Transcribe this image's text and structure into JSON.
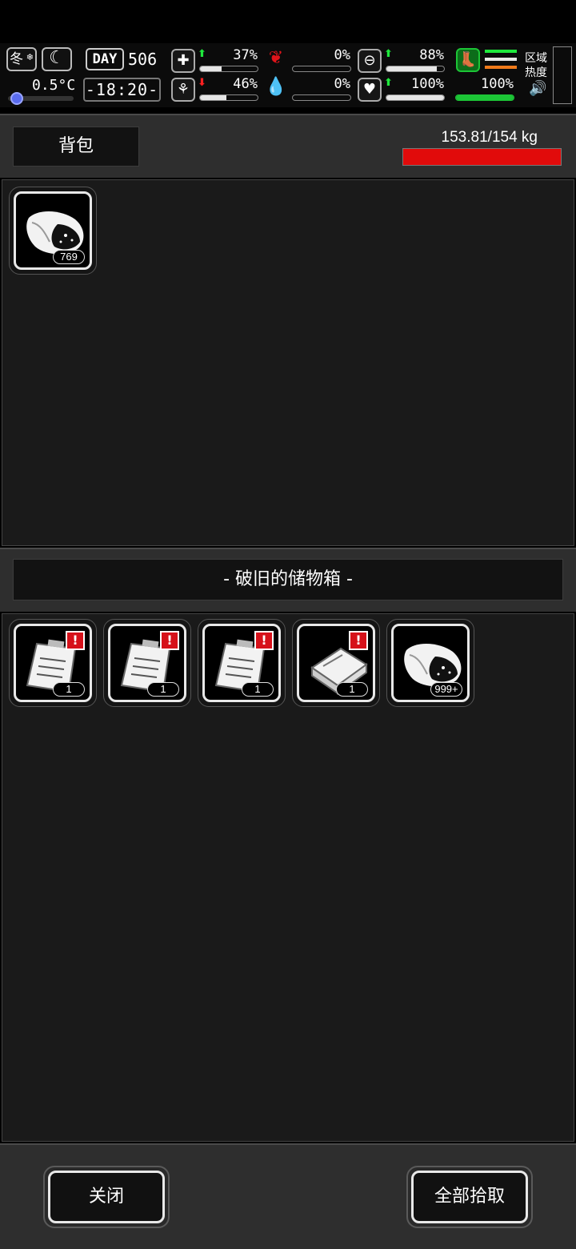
{
  "hud": {
    "season": "冬",
    "season_icon": "snowflake-icon",
    "time_icon": "moon-icon",
    "temperature": "0.5°C",
    "temperature_level": 0.05,
    "day_label": "DAY",
    "day_number": "506",
    "clock": "-18:20-",
    "stats": {
      "health": {
        "icon": "first-aid-icon",
        "trend": "up",
        "value": "37%",
        "level": 0.37
      },
      "hunger": {
        "icon": "stomach-icon",
        "value": "0%",
        "level": 0.0
      },
      "immunity": {
        "icon": "pill-icon",
        "trend": "up",
        "value": "88%",
        "level": 0.88
      },
      "sanity": {
        "icon": "brain-icon",
        "trend": "down",
        "value": "46%",
        "level": 0.46
      },
      "thirst": {
        "icon": "water-drop-icon",
        "value": "0%",
        "level": 0.0
      },
      "heart": {
        "icon": "heart-icon",
        "trend": "up",
        "value": "100%",
        "level": 1.0
      },
      "stamina": {
        "icon": "boot-icon",
        "value": "100%",
        "level": 1.0
      }
    },
    "region_heat_label": "区域热度",
    "sound_icon": "speaker-icon"
  },
  "backpack": {
    "tab_label": "背包",
    "weight_text": "153.81/154 kg",
    "weight_level": 0.999,
    "items": [
      {
        "icon": "meat-icon",
        "count": "769"
      }
    ]
  },
  "container": {
    "title": "- 破旧的储物箱 -",
    "items": [
      {
        "icon": "clipboard-icon",
        "count": "1",
        "new": true
      },
      {
        "icon": "clipboard-icon",
        "count": "1",
        "new": true
      },
      {
        "icon": "clipboard-icon",
        "count": "1",
        "new": true
      },
      {
        "icon": "book-icon",
        "count": "1",
        "new": true
      },
      {
        "icon": "meat-icon",
        "count": "999+",
        "new": false
      }
    ]
  },
  "footer": {
    "close_label": "关闭",
    "take_all_label": "全部拾取"
  },
  "colors": {
    "weight_bar": "#e10b0b",
    "stamina_bar": "#1cc536",
    "alert": "#d6111a",
    "temperature_knob": "#5a6cf0"
  }
}
